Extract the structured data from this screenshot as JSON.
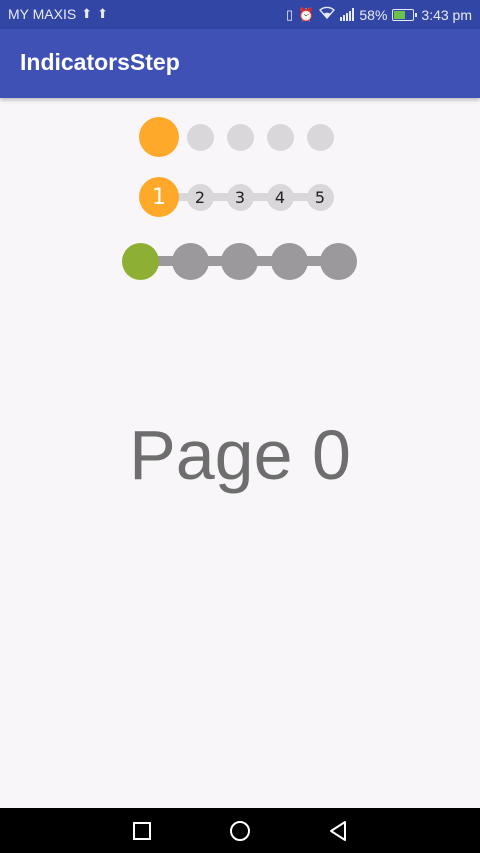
{
  "status_bar": {
    "carrier": "MY MAXIS",
    "battery_percent": "58%",
    "battery_level": 0.58,
    "time": "3:43 pm",
    "icons_left": [
      "usb-icon",
      "usb-icon"
    ],
    "icons_right": [
      "vibrate-icon",
      "alarm-icon",
      "wifi-icon",
      "signal-icon",
      "battery-icon"
    ]
  },
  "app_bar": {
    "title": "IndicatorsStep",
    "color": "#3f51b5"
  },
  "indicators": {
    "dots_simple": {
      "count": 5,
      "current": 0,
      "active_color": "#ffa92b",
      "inactive_color": "#d9d7da"
    },
    "numbered": {
      "labels": [
        "1",
        "2",
        "3",
        "4",
        "5"
      ],
      "current": 0,
      "active_color": "#ffa92b",
      "inactive_color": "#d9d7da",
      "line_color": "#d9d7da"
    },
    "connected": {
      "count": 5,
      "current": 0,
      "active_color": "#8daf34",
      "inactive_color": "#9b999c",
      "line_color": "#9b999c"
    }
  },
  "page": {
    "title": "Page 0"
  },
  "nav_bar": {
    "buttons": [
      "recents-button",
      "home-button",
      "back-button"
    ]
  }
}
